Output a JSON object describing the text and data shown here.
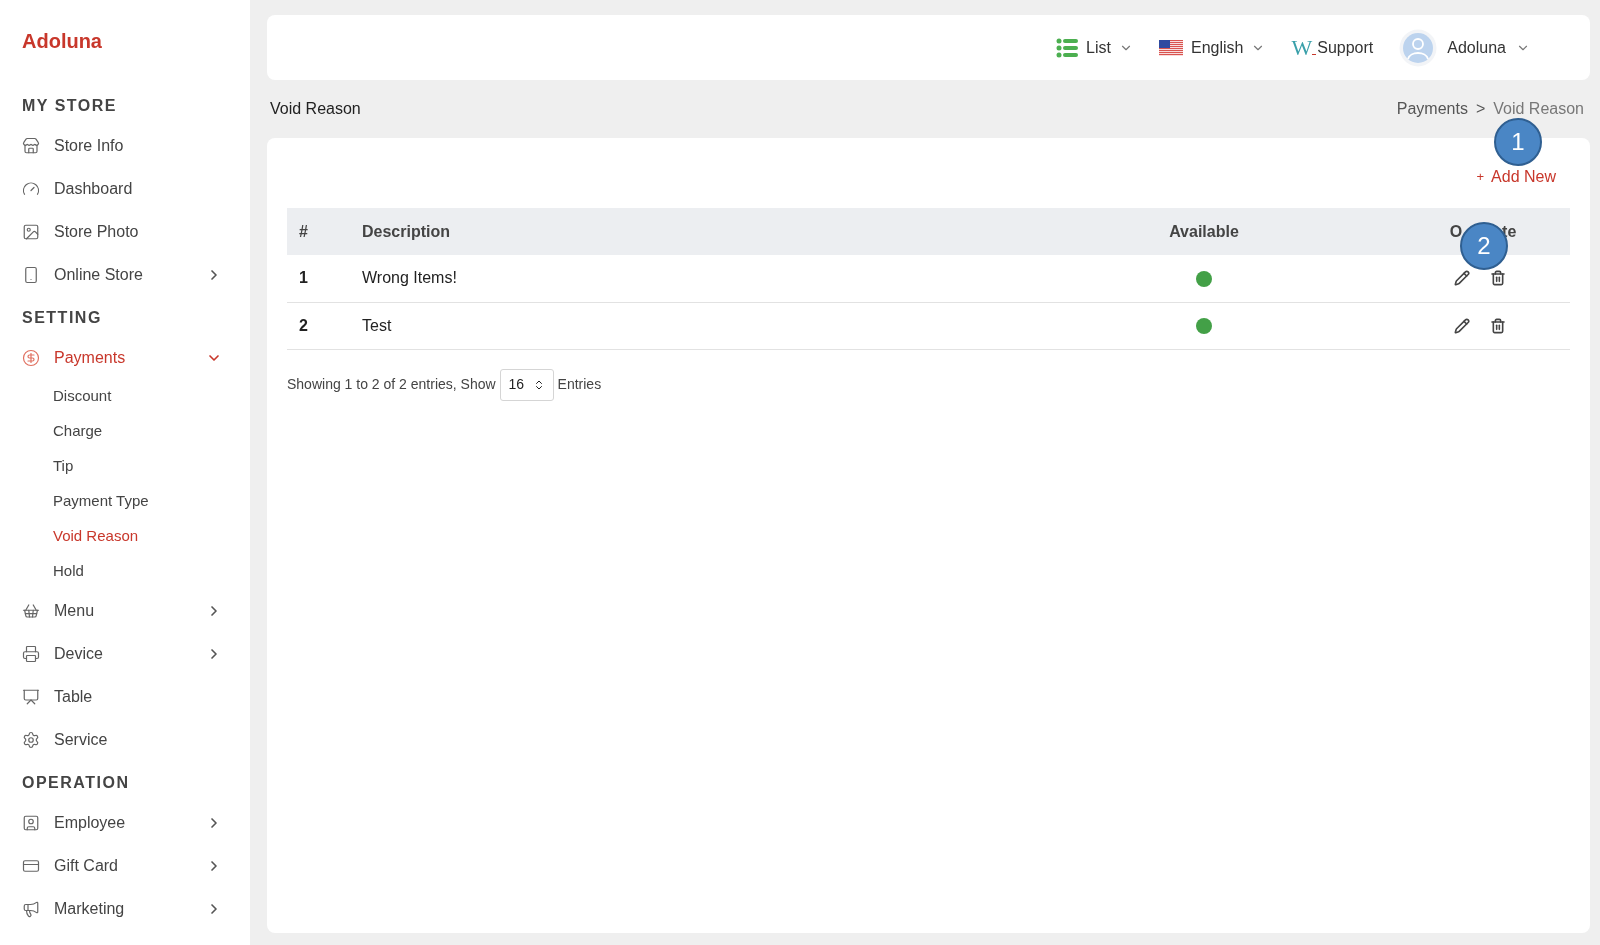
{
  "brand": "Adoluna",
  "sidebar": [
    {
      "kind": "section",
      "label": "MY STORE"
    },
    {
      "kind": "item",
      "label": "Store Info",
      "selected": false
    },
    {
      "kind": "item",
      "label": "Dashboard",
      "selected": false
    },
    {
      "kind": "item",
      "label": "Store Photo",
      "selected": false
    },
    {
      "kind": "item",
      "label": "Online Store",
      "selected": false,
      "expanded": false
    },
    {
      "kind": "section",
      "label": "SETTING"
    },
    {
      "kind": "item",
      "label": "Payments",
      "selected": true,
      "expanded": true,
      "children": [
        {
          "label": "Discount",
          "selected": false
        },
        {
          "label": "Charge",
          "selected": false
        },
        {
          "label": "Tip",
          "selected": false
        },
        {
          "label": "Payment Type",
          "selected": false
        },
        {
          "label": "Void Reason",
          "selected": true
        },
        {
          "label": "Hold",
          "selected": false
        }
      ]
    },
    {
      "kind": "item",
      "label": "Menu",
      "selected": false,
      "expanded": false
    },
    {
      "kind": "item",
      "label": "Device",
      "selected": false,
      "expanded": false
    },
    {
      "kind": "item",
      "label": "Table",
      "selected": false
    },
    {
      "kind": "item",
      "label": "Service",
      "selected": false
    },
    {
      "kind": "section",
      "label": "OPERATION"
    },
    {
      "kind": "item",
      "label": "Employee",
      "selected": false,
      "expanded": false
    },
    {
      "kind": "item",
      "label": "Gift Card",
      "selected": false,
      "expanded": false
    },
    {
      "kind": "item",
      "label": "Marketing",
      "selected": false,
      "expanded": false
    }
  ],
  "topbar": {
    "view": "List",
    "language": "English",
    "support_logo": "W",
    "support": "Support",
    "user": "Adoluna"
  },
  "page_title": "Void Reason",
  "breadcrumb": [
    "Payments",
    ">",
    "Void Reason"
  ],
  "add_button": {
    "icon": "+",
    "label": "Add New"
  },
  "table": {
    "columns": [
      [
        "#"
      ],
      [
        "Description"
      ],
      [
        "Available"
      ],
      [
        "O",
        "te"
      ]
    ],
    "rows": [
      {
        "index": "1",
        "description": "Wrong Items!",
        "available": true
      },
      {
        "index": "2",
        "description": "Test",
        "available": true
      }
    ]
  },
  "footer": {
    "summary": "Showing 1 to 2 of 2 entries, Show",
    "page_size": "16",
    "suffix": "Entries"
  },
  "callouts": [
    {
      "label": "1"
    },
    {
      "label": "2"
    }
  ]
}
